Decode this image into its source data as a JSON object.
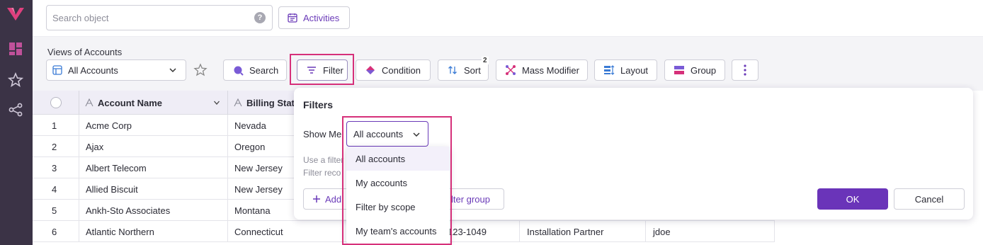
{
  "search": {
    "placeholder": "Search object",
    "help": "?"
  },
  "activities": {
    "label": "Activities"
  },
  "views": {
    "label": "Views of Accounts",
    "selected": "All Accounts"
  },
  "toolbar": {
    "search": "Search",
    "filter": "Filter",
    "condition": "Condition",
    "sort": "Sort",
    "sort_badge": "2",
    "mass_modifier": "Mass Modifier",
    "layout": "Layout",
    "group": "Group"
  },
  "grid": {
    "columns": [
      "Account Name",
      "Billing State"
    ],
    "rows": [
      {
        "num": "1",
        "name": "Acme Corp",
        "state": "Nevada"
      },
      {
        "num": "2",
        "name": "Ajax",
        "state": "Oregon"
      },
      {
        "num": "3",
        "name": "Albert Telecom",
        "state": "New Jersey"
      },
      {
        "num": "4",
        "name": "Allied Biscuit",
        "state": "New Jersey"
      },
      {
        "num": "5",
        "name": "Ankh-Sto Associates",
        "state": "Montana"
      },
      {
        "num": "6",
        "name": "Atlantic Northern",
        "state": "Connecticut",
        "phone": "123-1049",
        "type": "Installation Partner",
        "owner": "jdoe"
      }
    ]
  },
  "filters": {
    "title": "Filters",
    "show_me_label": "Show Me",
    "show_me_value": "All accounts",
    "help_line1": "Use a filter",
    "help_line2": "Filter reco",
    "add_label": "Add",
    "add_group_label": "lter group",
    "ok": "OK",
    "cancel": "Cancel",
    "options": [
      "All accounts",
      "My accounts",
      "Filter by scope",
      "My team's accounts"
    ]
  },
  "colors": {
    "accent": "#6a34b9",
    "highlight": "#d6307a",
    "rail": "#3b3346"
  }
}
